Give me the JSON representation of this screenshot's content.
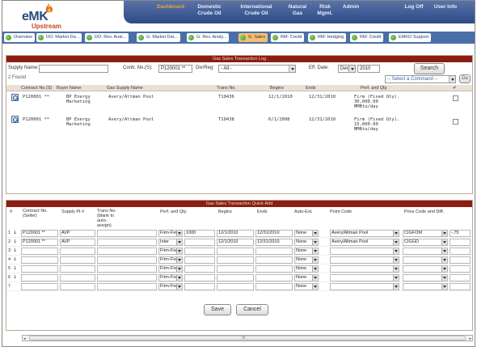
{
  "app": {
    "logo_main": "eMK",
    "logo_sub": "Upstream"
  },
  "topnav": [
    {
      "label": "Dashboard",
      "active": true
    },
    {
      "label": "Domestic\nCrude Oil",
      "active": false
    },
    {
      "label": "International\nCrude Oil",
      "active": false
    },
    {
      "label": "Natural\nGas",
      "active": false
    },
    {
      "label": "Risk\nMgmt.",
      "active": false
    },
    {
      "label": "Admin",
      "active": false
    },
    {
      "label": "Log Off",
      "active": false
    },
    {
      "label": "User Info",
      "active": false
    }
  ],
  "tabs": [
    {
      "label": "Overview"
    },
    {
      "label": "DO: Market Da..."
    },
    {
      "label": "DO: Rev. Anal..."
    },
    {
      "label": "G: Market Dat..."
    },
    {
      "label": "G: Rev. Analy..."
    },
    {
      "label": "G: Sales",
      "active": true
    },
    {
      "label": "RM: Credit"
    },
    {
      "label": "RM: Hedging"
    },
    {
      "label": "RM: Credit"
    },
    {
      "label": "EMKO Support"
    }
  ],
  "log": {
    "title": "Gas Sales Transaction Log",
    "supply_name_label": "Supply Name:",
    "supply_name_value": "",
    "contr_label": "Contr. No.(S):",
    "contr_value": "P120001 **",
    "div_label": "Div/Reg:",
    "div_value": "- All -",
    "eff_label": "Eff. Date:",
    "eff_month": "Dec",
    "eff_year": "2010",
    "search_label": "Search",
    "found_text": "2 Found",
    "command_value": "-- Select a Command --",
    "go_label": "Go",
    "headers": [
      "Contract No.(S)",
      "Buyer Name",
      "Gas Supply Name",
      "Trans No.",
      "Begins",
      "Ends",
      "Perf. and Qty.",
      "✔"
    ],
    "rows": [
      {
        "contract": "P120001 **",
        "buyer": "BP Energy\nMarketing",
        "supply": "Avery/Altman Pool",
        "trans": "T10436",
        "begins": "12/1/2010",
        "ends": "12/31/2010",
        "perf": "Firm (Fixed Qty).\n30,000.00\nMMBtu/day"
      },
      {
        "contract": "P120001 **",
        "buyer": "BP Energy\nMarketing",
        "supply": "Avery/Altman Pool",
        "trans": "T10438",
        "begins": "6/1/2008",
        "ends": "12/31/2010",
        "perf": "Firm (Fixed Qty).\n15,000.00\nMMBtu/day"
      }
    ]
  },
  "quickadd": {
    "title": "Gas Sales Transaction Quick-Add",
    "headers": [
      "#",
      "Contract No.\n(Seller)",
      "Supply Pt #",
      "Trans No.\n(blank to\nauto-\nassign)",
      "Perf. and Qty.",
      "Begins",
      "Ends",
      "Auto-Ext.",
      "Point Code",
      "Price Code and Diff."
    ],
    "rows": [
      {
        "num": "1",
        "contract": "P120001 **",
        "supply": "AVP",
        "perf": "Firm-Fxd",
        "qty": "1000",
        "begins": "12/1/2010",
        "ends": "12/31/2010",
        "ext": "None",
        "point": "Avery/Altman Pool",
        "price": "CIGFOM",
        "diff": "-.75"
      },
      {
        "num": "2",
        "contract": "P120001 **",
        "supply": "AVP",
        "perf": "Inter",
        "qty": "",
        "begins": "12/1/2010",
        "ends": "12/31/2010",
        "ext": "None",
        "point": "Avery/Altman Pool",
        "price": "CIGGD",
        "diff": ""
      },
      {
        "num": "3",
        "contract": "",
        "supply": "",
        "perf": "Firm-Fxd",
        "qty": "",
        "begins": "",
        "ends": "",
        "ext": "None",
        "point": "",
        "price": "",
        "diff": ""
      },
      {
        "num": "4",
        "contract": "",
        "supply": "",
        "perf": "Firm-Fxd",
        "qty": "",
        "begins": "",
        "ends": "",
        "ext": "None",
        "point": "",
        "price": "",
        "diff": ""
      },
      {
        "num": "5",
        "contract": "",
        "supply": "",
        "perf": "Firm-Fxd",
        "qty": "",
        "begins": "",
        "ends": "",
        "ext": "None",
        "point": "",
        "price": "",
        "diff": ""
      },
      {
        "num": "6",
        "contract": "",
        "supply": "",
        "perf": "Firm-Fxd",
        "qty": "",
        "begins": "",
        "ends": "",
        "ext": "None",
        "point": "",
        "price": "",
        "diff": ""
      },
      {
        "num": "7",
        "contract": "",
        "supply": "",
        "perf": "Firm-Fxd",
        "qty": "",
        "begins": "",
        "ends": "",
        "ext": "None",
        "point": "",
        "price": "",
        "diff": ""
      }
    ],
    "save_label": "Save",
    "cancel_label": "Cancel"
  },
  "scrollbar": {
    "center_mark": "III"
  },
  "colors": {
    "accent": "#4a6fa8",
    "panel_title": "#8c1d12",
    "active_nav": "#f0a23a"
  }
}
